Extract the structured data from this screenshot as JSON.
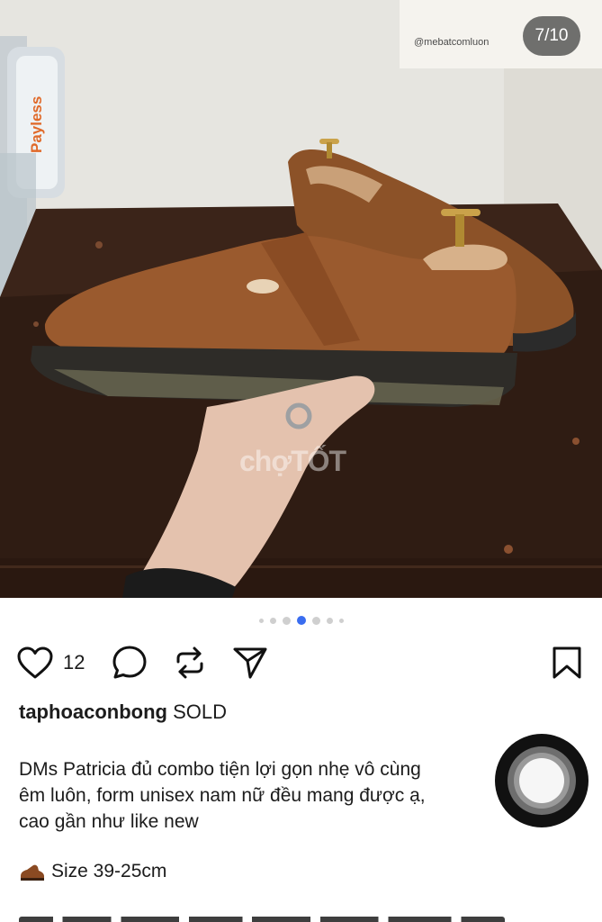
{
  "post": {
    "image_counter": "7/10",
    "watermark": "chợTỐT",
    "carousel": {
      "total_dots_visible": 7,
      "active_index": 3
    },
    "likes_count": "12",
    "username": "taphoaconbong",
    "status": "SOLD",
    "caption": "DMs Patricia đủ combo tiện lợi gọn nhẹ vô cùng\nêm luôn, form unisex nam nữ đều mang được ạ,\ncao gần như like new",
    "size_emoji_icon": "brown-shoe-icon",
    "size_text": "Size 39-25cm"
  },
  "poster_sign": "@mebatcomluon",
  "box_label": "Payless",
  "colors": {
    "accent_dot": "#3a6df0",
    "leather": "#9a5a2e",
    "table": "#3a2218"
  }
}
